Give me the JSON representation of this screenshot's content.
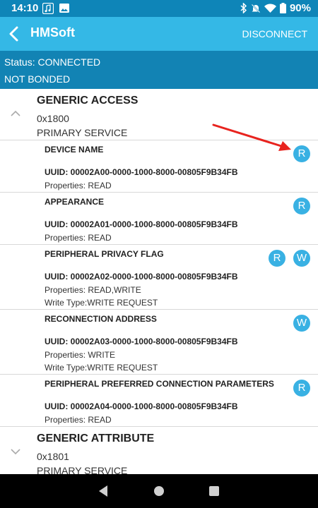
{
  "status_bar": {
    "time": "14:10",
    "icons": [
      "music-note-icon",
      "image-icon",
      "bluetooth-icon",
      "mute-icon",
      "wifi-icon",
      "battery-icon"
    ],
    "battery": "90%"
  },
  "app_bar": {
    "title": "HMSoft",
    "action": "DISCONNECT",
    "icons": [
      "back-icon"
    ]
  },
  "connection": {
    "status": "Status: CONNECTED",
    "bond": "NOT BONDED"
  },
  "services": [
    {
      "name": "GENERIC ACCESS",
      "uuid": "0x1800",
      "type": "PRIMARY SERVICE",
      "expanded": true,
      "characteristics": [
        {
          "name": "DEVICE NAME",
          "uuid": "UUID: 00002A00-0000-1000-8000-00805F9B34FB",
          "properties": "Properties: READ",
          "write_type": "",
          "ops": [
            "R"
          ]
        },
        {
          "name": "APPEARANCE",
          "uuid": "UUID: 00002A01-0000-1000-8000-00805F9B34FB",
          "properties": "Properties: READ",
          "write_type": "",
          "ops": [
            "R"
          ]
        },
        {
          "name": "PERIPHERAL PRIVACY FLAG",
          "uuid": "UUID: 00002A02-0000-1000-8000-00805F9B34FB",
          "properties": "Properties: READ,WRITE",
          "write_type": "Write Type:WRITE REQUEST",
          "ops": [
            "R",
            "W"
          ]
        },
        {
          "name": "RECONNECTION ADDRESS",
          "uuid": "UUID: 00002A03-0000-1000-8000-00805F9B34FB",
          "properties": "Properties: WRITE",
          "write_type": "Write Type:WRITE REQUEST",
          "ops": [
            "W"
          ]
        },
        {
          "name": "PERIPHERAL PREFERRED CONNECTION PARAMETERS",
          "uuid": "UUID: 00002A04-0000-1000-8000-00805F9B34FB",
          "properties": "Properties: READ",
          "write_type": "",
          "ops": [
            "R"
          ]
        }
      ]
    },
    {
      "name": "GENERIC ATTRIBUTE",
      "uuid": "0x1801",
      "type": "PRIMARY SERVICE",
      "expanded": false
    }
  ],
  "annotation": {
    "color": "#e8231e",
    "icon": "red-arrow"
  },
  "nav_bar": {
    "icons": [
      "nav-back-icon",
      "nav-home-icon",
      "nav-recents-icon"
    ]
  },
  "colors": {
    "status_bar": "#0e85b8",
    "app_bar": "#34b8e6",
    "status_band": "#1283b4",
    "op_button": "#39b1e3"
  }
}
